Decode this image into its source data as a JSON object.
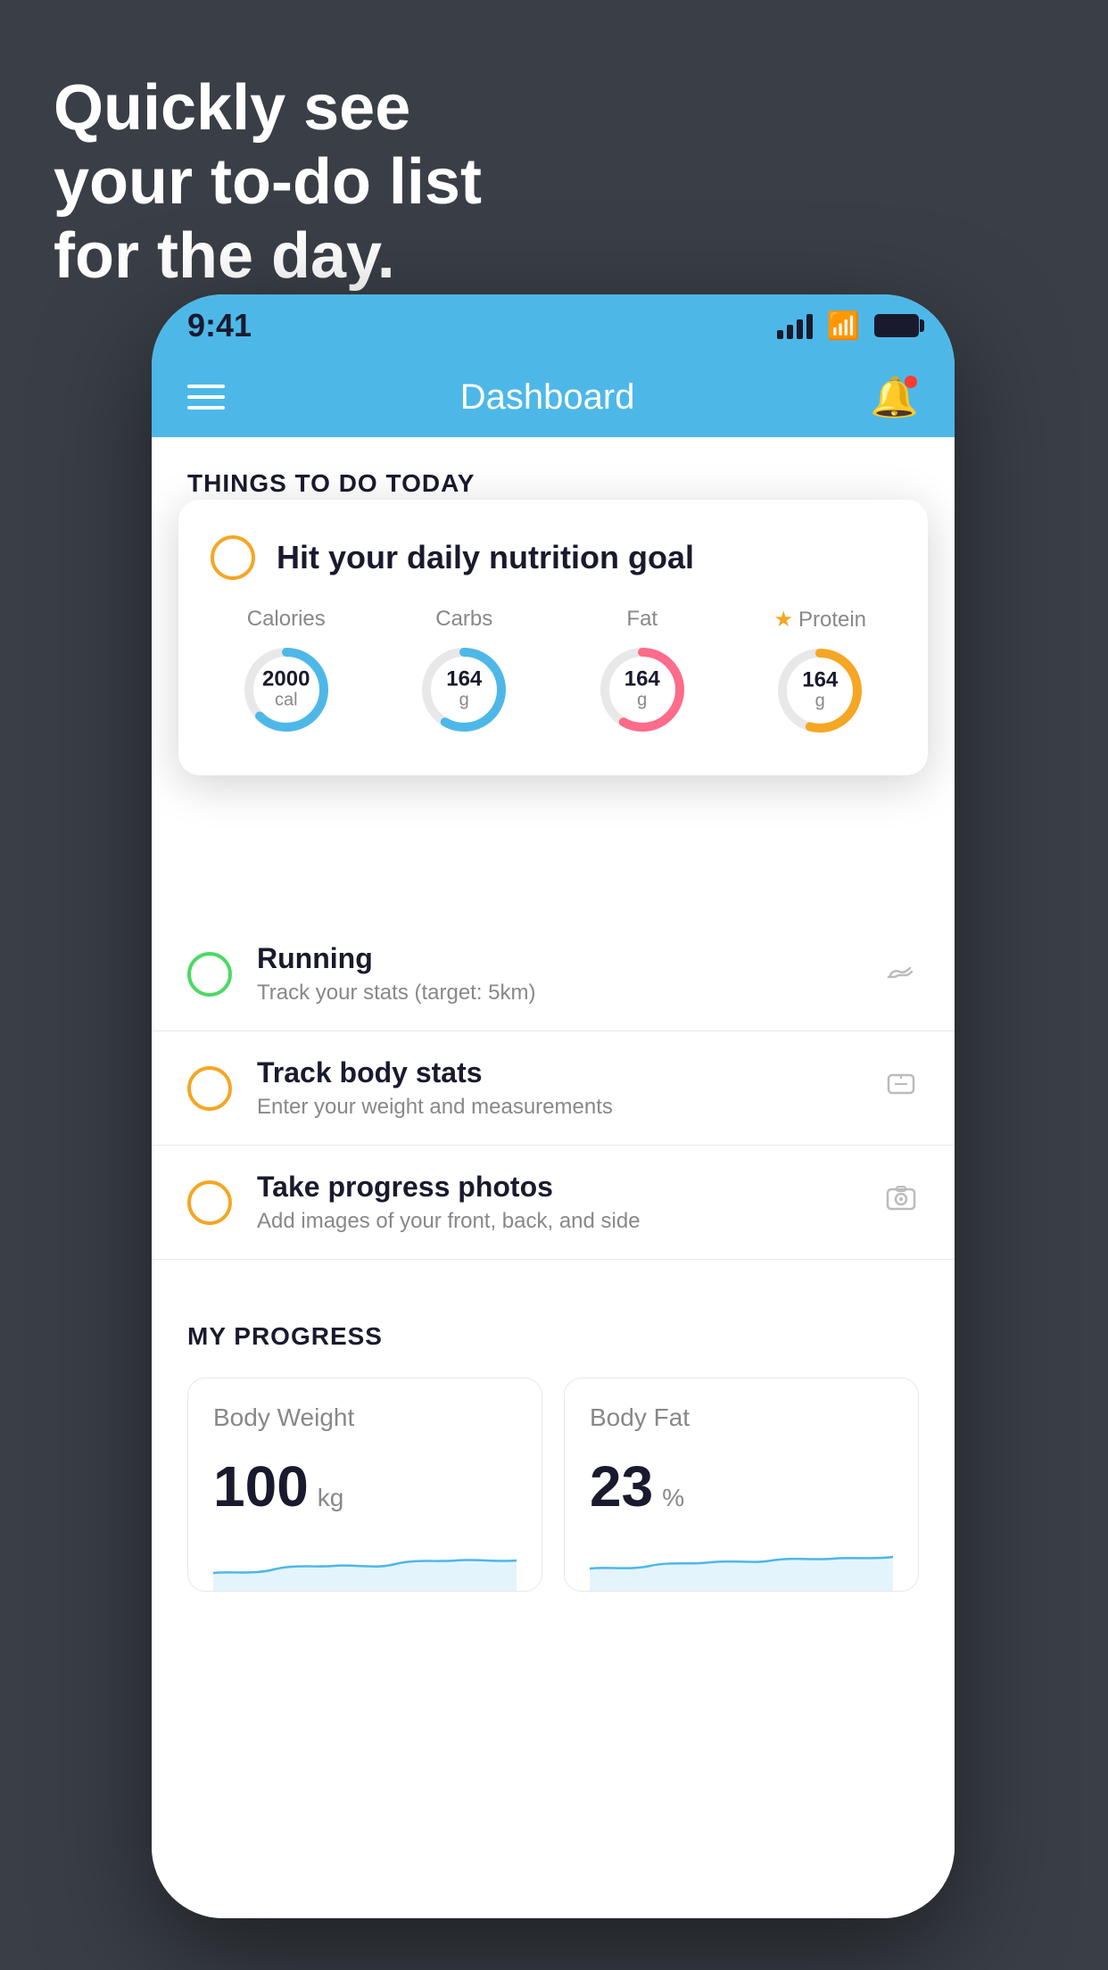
{
  "background": {
    "color": "#3a3f47"
  },
  "headline": {
    "line1": "Quickly see",
    "line2": "your to-do list",
    "line3": "for the day."
  },
  "phone": {
    "statusBar": {
      "time": "9:41"
    },
    "navBar": {
      "title": "Dashboard"
    },
    "sectionHeader": "THINGS TO DO TODAY",
    "floatingCard": {
      "title": "Hit your daily nutrition goal",
      "checkboxState": "incomplete",
      "nutrition": [
        {
          "label": "Calories",
          "value": "2000",
          "unit": "cal",
          "type": "blue",
          "starred": false
        },
        {
          "label": "Carbs",
          "value": "164",
          "unit": "g",
          "type": "blue",
          "starred": false
        },
        {
          "label": "Fat",
          "value": "164",
          "unit": "g",
          "type": "pink",
          "starred": false
        },
        {
          "label": "Protein",
          "value": "164",
          "unit": "g",
          "type": "gold",
          "starred": true
        }
      ]
    },
    "todoItems": [
      {
        "title": "Running",
        "subtitle": "Track your stats (target: 5km)",
        "icon": "👟",
        "checkboxColor": "green"
      },
      {
        "title": "Track body stats",
        "subtitle": "Enter your weight and measurements",
        "icon": "⚖",
        "checkboxColor": "yellow"
      },
      {
        "title": "Take progress photos",
        "subtitle": "Add images of your front, back, and side",
        "icon": "🖼",
        "checkboxColor": "yellow"
      }
    ],
    "progressSection": {
      "header": "MY PROGRESS",
      "cards": [
        {
          "title": "Body Weight",
          "value": "100",
          "unit": "kg"
        },
        {
          "title": "Body Fat",
          "value": "23",
          "unit": "%"
        }
      ]
    }
  }
}
